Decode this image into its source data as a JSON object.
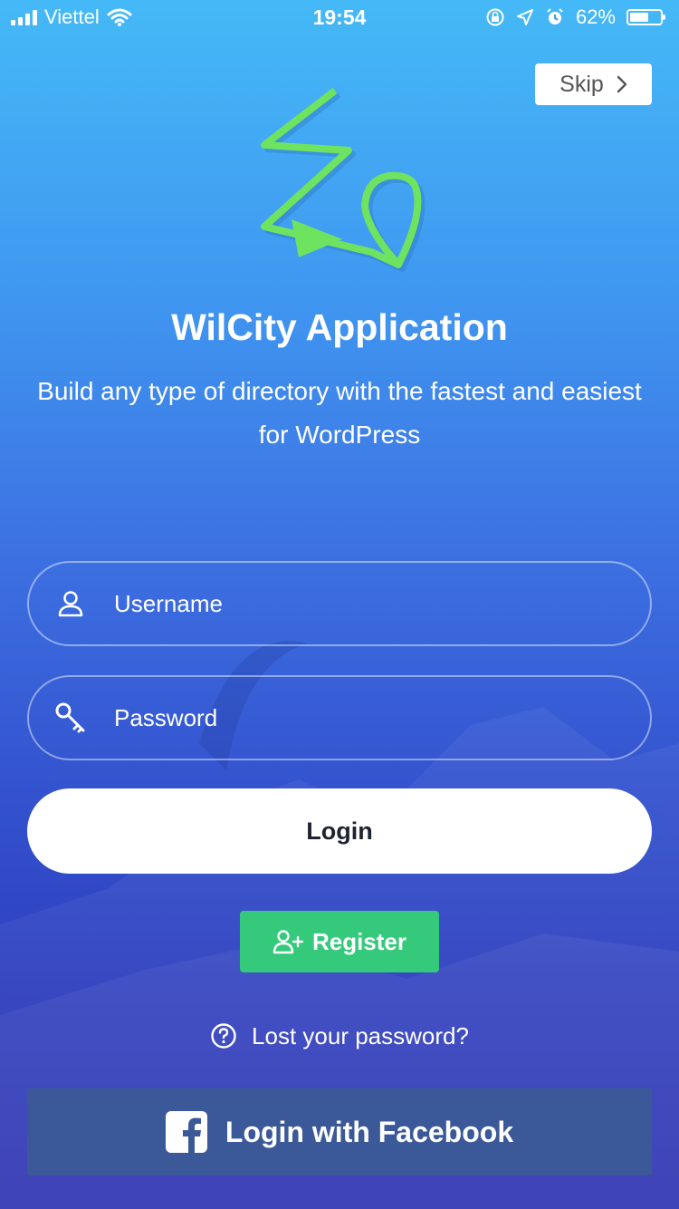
{
  "status_bar": {
    "carrier": "Viettel",
    "time": "19:54",
    "battery": "62%",
    "battery_level": 0.62
  },
  "skip": {
    "label": "Skip",
    "icon": "chevron-right-icon"
  },
  "app": {
    "title": "WilCity Application",
    "subtitle": "Build any type of directory with the fastest and easiest for WordPress",
    "logo_color": "#6ee35f"
  },
  "form": {
    "username_placeholder": "Username",
    "username_value": "",
    "password_placeholder": "Password",
    "password_value": "",
    "login_label": "Login"
  },
  "register": {
    "label": "Register",
    "color": "#34c97b"
  },
  "lost_password": {
    "label": "Lost your password?"
  },
  "facebook": {
    "label": "Login with Facebook",
    "color": "#3b5998"
  }
}
